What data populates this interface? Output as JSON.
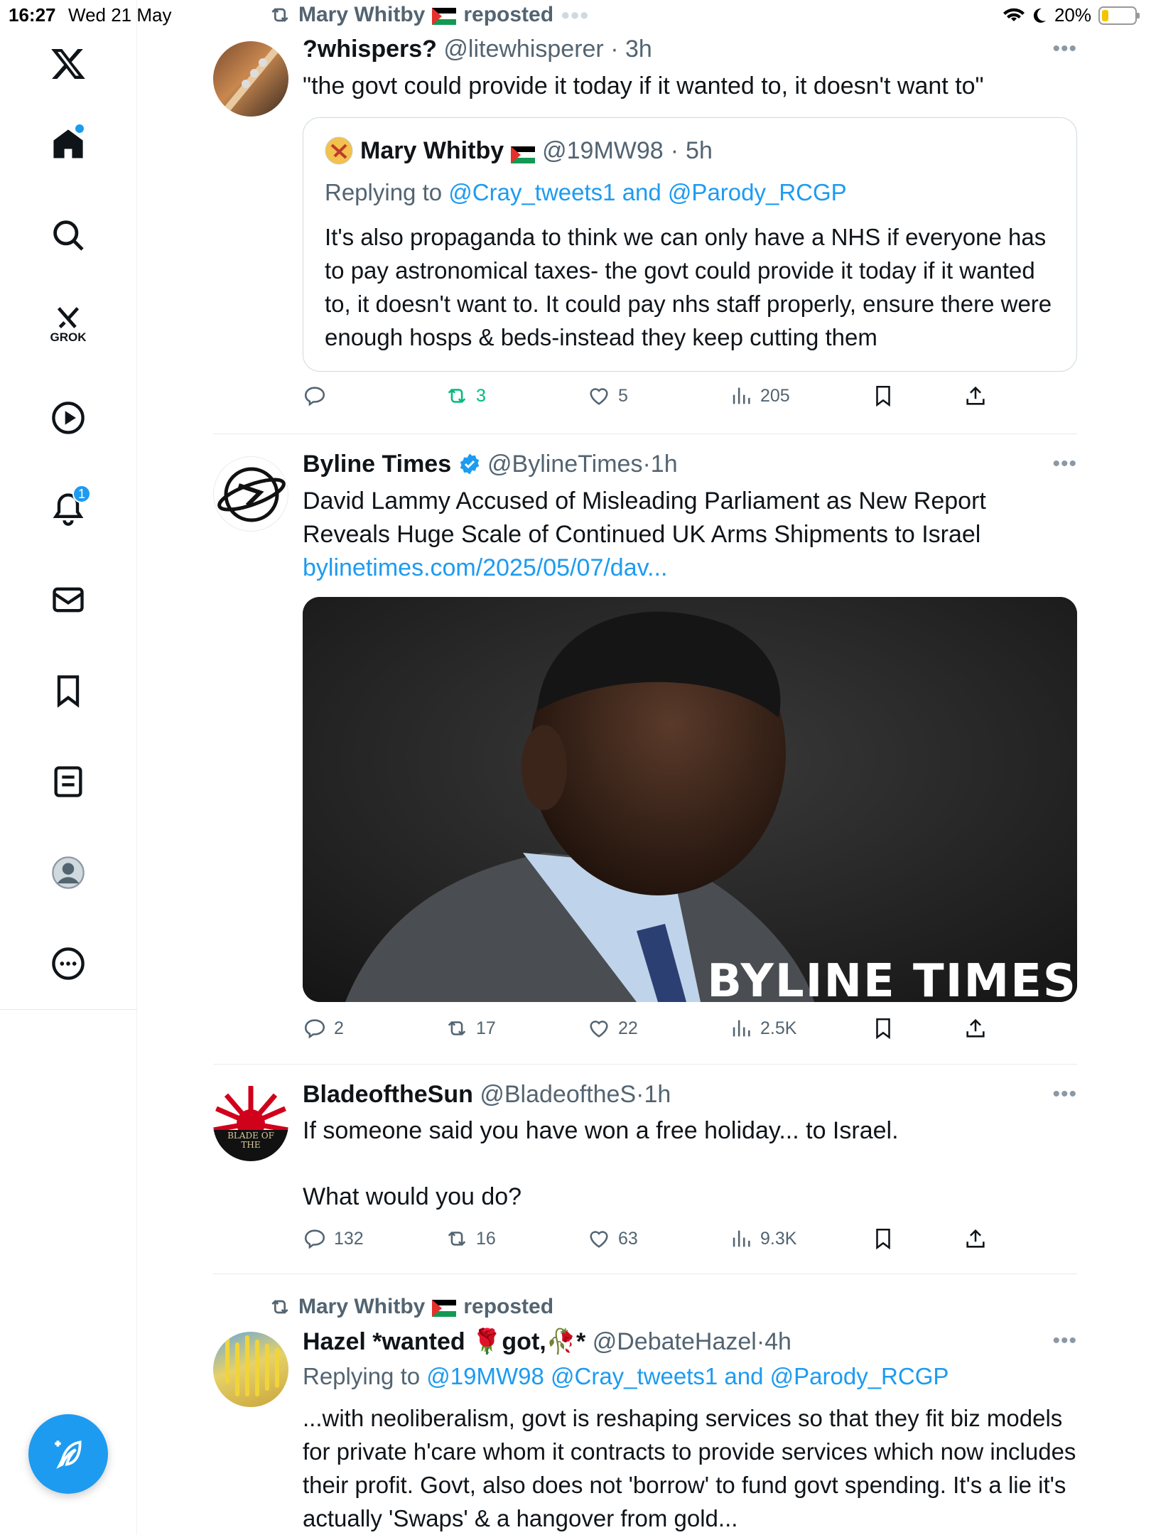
{
  "status_bar": {
    "time": "16:27",
    "date": "Wed 21 May",
    "battery": "20%"
  },
  "sidebar": {
    "grok_label": "GROK",
    "notifications_badge": "1"
  },
  "tweets": [
    {
      "repost_by": "Mary Whitby",
      "repost_suffix": "reposted",
      "name": "?whispers?",
      "handle": "@litewhisperer",
      "time": "3h",
      "text": "\"the govt could provide it today if it wanted to, it doesn't want to\"",
      "quote": {
        "name": "Mary Whitby",
        "handle": "@19MW98",
        "time": "5h",
        "reply_prefix": "Replying to",
        "reply_targets": "@Cray_tweets1 and @Parody_RCGP",
        "text": "It's also propaganda to think we can only have a NHS if everyone has to pay astronomical taxes- the govt could provide it today if it wanted to, it doesn't want to. It could pay nhs staff properly, ensure there were enough hosps & beds-instead they keep cutting them"
      },
      "replies": "",
      "reposts": "3",
      "likes": "5",
      "views": "205"
    },
    {
      "name": "Byline Times",
      "handle": "@BylineTimes",
      "time": "1h",
      "text": "David Lammy Accused of Misleading Parliament as New Report Reveals Huge Scale of Continued UK Arms Shipments to Israel",
      "link": "bylinetimes.com/2025/05/07/dav...",
      "media_watermark": "BYLINE TIMES",
      "replies": "2",
      "reposts": "17",
      "likes": "22",
      "views": "2.5K"
    },
    {
      "name": "BladeoftheSun",
      "handle": "@BladeoftheS",
      "time": "1h",
      "text_line1": "If someone said you have won a free holiday... to Israel.",
      "text_line2": "What would you do?",
      "avatar_text": "BLADE OF THE",
      "replies": "132",
      "reposts": "16",
      "likes": "63",
      "views": "9.3K"
    },
    {
      "repost_by": "Mary Whitby",
      "repost_suffix": "reposted",
      "name": "Hazel *wanted 🌹got,🥀*",
      "handle": "@DebateHazel",
      "time": "4h",
      "reply_prefix": "Replying to",
      "reply_targets": "@19MW98 @Cray_tweets1 and @Parody_RCGP",
      "text": "...with neoliberalism, govt is reshaping services so that they fit biz models for private h'care whom it contracts to provide services which now includes their profit. Govt, also does not 'borrow' to fund govt spending.  It's a lie it's actually 'Swaps' & a hangover from gold..."
    }
  ],
  "colors": {
    "accent": "#1d9bf0",
    "repost_green": "#00ba7c",
    "muted": "#536471"
  }
}
